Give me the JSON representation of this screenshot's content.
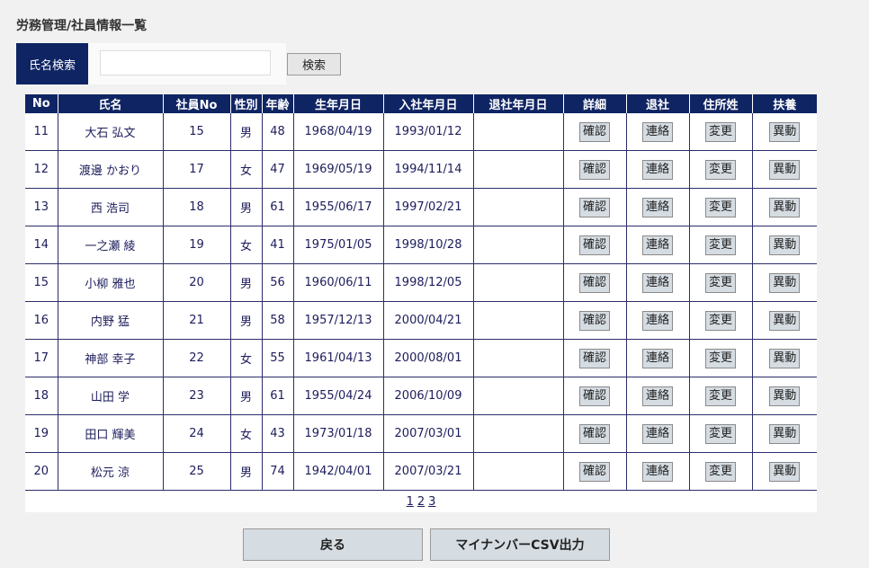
{
  "page_title": "労務管理/社員情報一覧",
  "search": {
    "label": "氏名検索",
    "value": "",
    "placeholder": "",
    "button": "検索"
  },
  "table": {
    "headers": [
      "No",
      "氏名",
      "社員No",
      "性別",
      "年齢",
      "生年月日",
      "入社年月日",
      "退社年月日",
      "詳細",
      "退社",
      "住所姓",
      "扶養"
    ],
    "rows": [
      {
        "no": "11",
        "name": "大石 弘文",
        "emp": "15",
        "sex": "男",
        "age": "48",
        "birth": "1968/04/19",
        "join": "1993/01/12",
        "leave": ""
      },
      {
        "no": "12",
        "name": "渡邊 かおり",
        "emp": "17",
        "sex": "女",
        "age": "47",
        "birth": "1969/05/19",
        "join": "1994/11/14",
        "leave": ""
      },
      {
        "no": "13",
        "name": "西 浩司",
        "emp": "18",
        "sex": "男",
        "age": "61",
        "birth": "1955/06/17",
        "join": "1997/02/21",
        "leave": ""
      },
      {
        "no": "14",
        "name": "一之瀬 綾",
        "emp": "19",
        "sex": "女",
        "age": "41",
        "birth": "1975/01/05",
        "join": "1998/10/28",
        "leave": ""
      },
      {
        "no": "15",
        "name": "小柳 雅也",
        "emp": "20",
        "sex": "男",
        "age": "56",
        "birth": "1960/06/11",
        "join": "1998/12/05",
        "leave": ""
      },
      {
        "no": "16",
        "name": "内野 猛",
        "emp": "21",
        "sex": "男",
        "age": "58",
        "birth": "1957/12/13",
        "join": "2000/04/21",
        "leave": ""
      },
      {
        "no": "17",
        "name": "神部 幸子",
        "emp": "22",
        "sex": "女",
        "age": "55",
        "birth": "1961/04/13",
        "join": "2000/08/01",
        "leave": ""
      },
      {
        "no": "18",
        "name": "山田 学",
        "emp": "23",
        "sex": "男",
        "age": "61",
        "birth": "1955/04/24",
        "join": "2006/10/09",
        "leave": ""
      },
      {
        "no": "19",
        "name": "田口 輝美",
        "emp": "24",
        "sex": "女",
        "age": "43",
        "birth": "1973/01/18",
        "join": "2007/03/01",
        "leave": ""
      },
      {
        "no": "20",
        "name": "松元 涼",
        "emp": "25",
        "sex": "男",
        "age": "74",
        "birth": "1942/04/01",
        "join": "2007/03/21",
        "leave": ""
      }
    ],
    "buttons": {
      "detail": "確認",
      "leave": "連絡",
      "address": "変更",
      "support": "異動"
    }
  },
  "pager": {
    "pages": [
      "1",
      "2",
      "3"
    ]
  },
  "footer": {
    "back": "戻る",
    "csv": "マイナンバーCSV出力"
  },
  "colors": {
    "header_bg": "#0f2463",
    "button_bg": "#d5dce2",
    "page_bg": "#f1f1f1"
  }
}
